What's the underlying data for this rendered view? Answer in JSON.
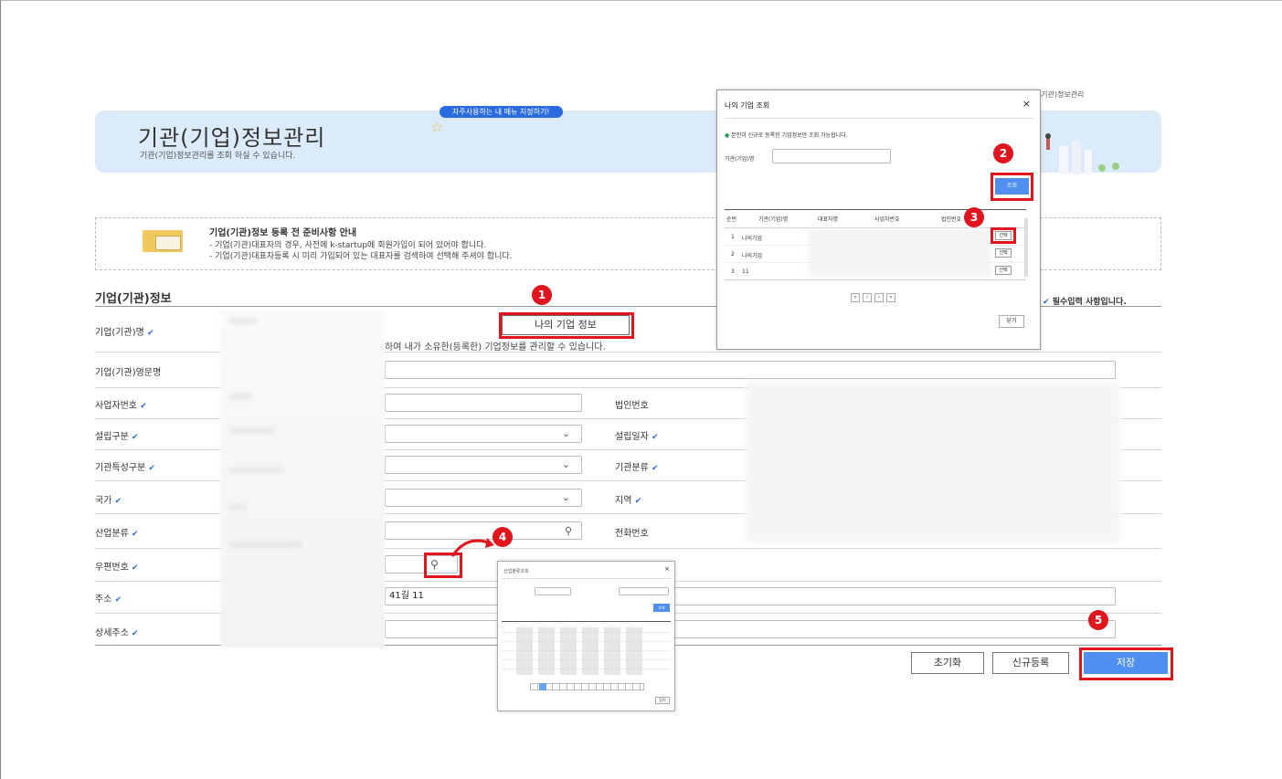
{
  "header": {
    "pill": "자주사용하는 내 메뉴 지정하기!",
    "title": "기관(기업)정보관리",
    "subtitle": "기관(기업)정보관리를 조회 하실 수 있습니다.",
    "breadcrumb": "(기관)정보관리"
  },
  "notice": {
    "title": "기업(기관)정보 등록 전 준비사항 안내",
    "lines": [
      "- 기업(기관)대표자의 경우, 사전에 k-startup에 회원가입이 되어 있어야 합니다.",
      "- 기업(기관)대표자등록 시 미리 가입되어 있는 대표자를 검색하여 선택해 주셔야 합니다."
    ]
  },
  "form": {
    "section_title": "기업(기관)정보",
    "required_note": "필수입력 사항입니다.",
    "my_info_button": "나의 기업 정보",
    "help_text": "하여 내가 소유한(등록한) 기업정보를 관리할 수 있습니다.",
    "labels": {
      "name": "기업(기관)명",
      "eng_name": "기업(기관)영문명",
      "biz_no": "사업자번호",
      "corp_no": "법인번호",
      "est_type": "설립구분",
      "est_date": "설립일자",
      "org_type": "기관특성구분",
      "org_class": "기관분류",
      "country": "국가",
      "region": "지역",
      "industry": "산업분류",
      "phone": "전화번호",
      "zip": "우편번호",
      "address": "주소",
      "address_detail": "상세주소"
    },
    "address_value": "41길 11"
  },
  "actions": {
    "reset": "초기화",
    "new": "신규등록",
    "save": "저장"
  },
  "badges": [
    "1",
    "2",
    "3",
    "4",
    "5"
  ],
  "modal_company": {
    "title": "나의 기업 조회",
    "close": "×",
    "info": "본인이 신규로 등록한 기업정보만 조회 가능합니다.",
    "field_label": "기관(기업)명",
    "search_button": "조회",
    "columns": [
      "순번",
      "기관(기업)명",
      "대표자명",
      "사업자번호",
      "법인번호"
    ],
    "rows": [
      {
        "no": "1",
        "name": "나의기업",
        "select": "선택"
      },
      {
        "no": "2",
        "name": "나의기업",
        "select": "선택"
      },
      {
        "no": "3",
        "name": "11",
        "select": "선택"
      }
    ],
    "pager": [
      "«",
      "‹",
      "›",
      "»"
    ],
    "close_button": "닫기"
  },
  "modal_industry": {
    "title": "산업분류조회",
    "close": "×",
    "search_button": "조회",
    "close_button": "닫기",
    "pages": [
      "1",
      "2",
      "3",
      "4",
      "5",
      "6",
      "7",
      "8",
      "9",
      "10"
    ]
  },
  "colors": {
    "accent": "#2b6be0",
    "save_button": "#4f8ff0",
    "highlight": "#e0151d",
    "banner": "#dcebf9"
  }
}
